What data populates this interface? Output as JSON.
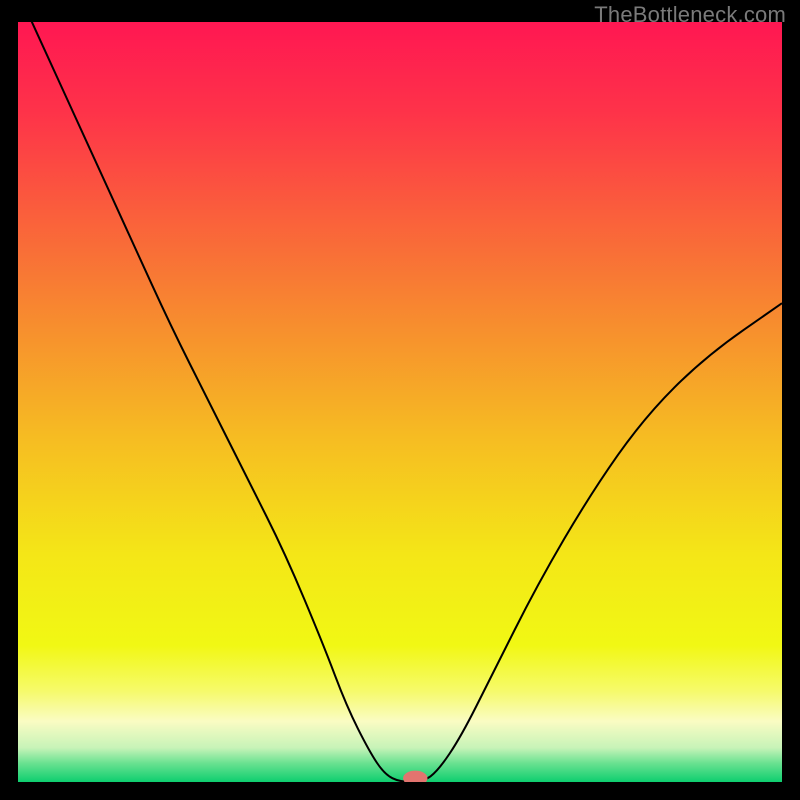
{
  "watermark": "TheBottleneck.com",
  "chart_data": {
    "type": "line",
    "title": "",
    "xlabel": "",
    "ylabel": "",
    "xlim": [
      0,
      100
    ],
    "ylim": [
      0,
      100
    ],
    "grid": false,
    "legend": false,
    "background_gradient": {
      "orientation": "vertical",
      "stops": [
        {
          "offset": 0.0,
          "color": "#ff1752"
        },
        {
          "offset": 0.12,
          "color": "#fe3349"
        },
        {
          "offset": 0.25,
          "color": "#fa5e3c"
        },
        {
          "offset": 0.4,
          "color": "#f78e2e"
        },
        {
          "offset": 0.55,
          "color": "#f6bd22"
        },
        {
          "offset": 0.7,
          "color": "#f4e617"
        },
        {
          "offset": 0.82,
          "color": "#f1f814"
        },
        {
          "offset": 0.88,
          "color": "#f6fa6a"
        },
        {
          "offset": 0.92,
          "color": "#fafcc3"
        },
        {
          "offset": 0.955,
          "color": "#c7f3b8"
        },
        {
          "offset": 0.975,
          "color": "#6be291"
        },
        {
          "offset": 1.0,
          "color": "#0ece6f"
        }
      ]
    },
    "series": [
      {
        "name": "bottleneck-curve",
        "color": "#000000",
        "x": [
          0,
          5,
          10,
          15,
          20,
          25,
          30,
          35,
          40,
          43,
          46,
          48,
          50,
          53,
          55,
          58,
          62,
          68,
          75,
          82,
          90,
          100
        ],
        "y": [
          104,
          93,
          82,
          71,
          60,
          50,
          40,
          30,
          18,
          10,
          4,
          1,
          0,
          0,
          1.5,
          6,
          14,
          26,
          38,
          48,
          56,
          63
        ]
      }
    ],
    "markers": [
      {
        "name": "optimal-point",
        "x": 52,
        "y": 0.5,
        "color": "#e2746f",
        "rx": 1.6,
        "ry": 1.0
      }
    ]
  }
}
